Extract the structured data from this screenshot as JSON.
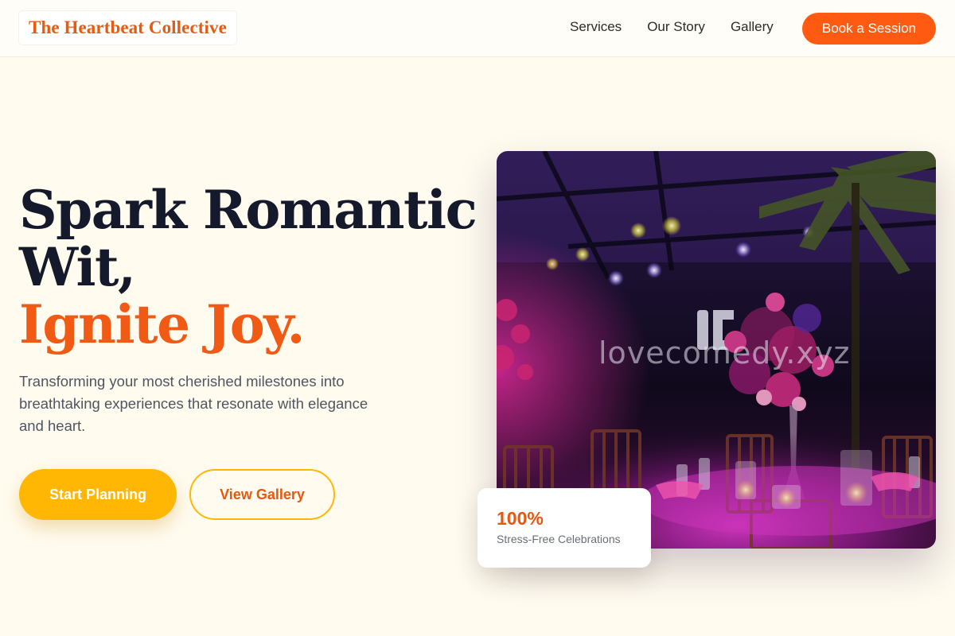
{
  "header": {
    "brand": "The Heartbeat Collective",
    "nav": [
      "Services",
      "Our Story",
      "Gallery"
    ],
    "cta": "Book a Session"
  },
  "hero": {
    "title_line1": "Spark Romantic",
    "title_line2": "Wit,",
    "title_accent": "Ignite Joy.",
    "subtitle": "Transforming your most cherished milestones into breathtaking experiences that resonate with elegance and heart.",
    "primary_button": "Start Planning",
    "secondary_button": "View Gallery"
  },
  "image": {
    "watermark": "lovecomedy.xyz",
    "description": "event-venue-photo"
  },
  "stat": {
    "value": "100%",
    "label": "Stress-Free Celebrations"
  },
  "colors": {
    "accent": "#f05a14",
    "cta": "#ff5a12",
    "primary_button": "#ffb703",
    "background": "#fffbef",
    "heading": "#141a2c"
  }
}
